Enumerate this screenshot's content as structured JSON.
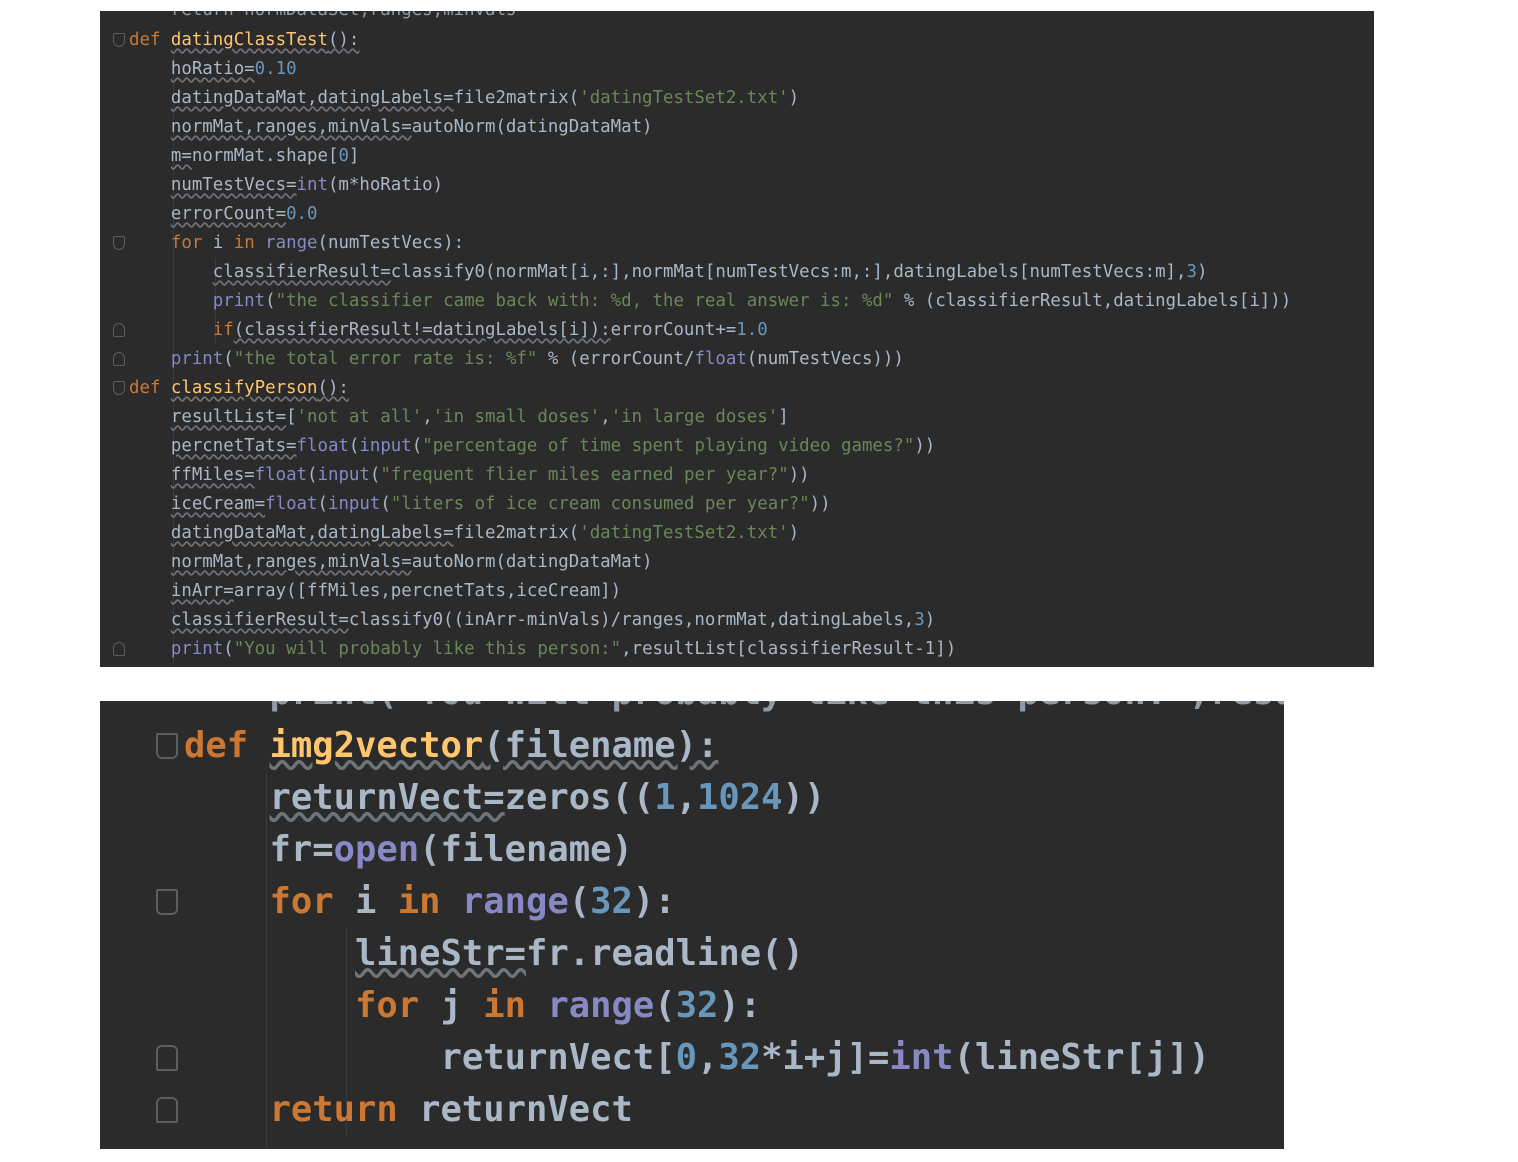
{
  "top_editor": {
    "ghost": "    return normDataSet,ranges,minVals",
    "lines": [
      [
        {
          "t": "def ",
          "c": "kw"
        },
        {
          "t": "datingClassTest",
          "c": "fn wav"
        },
        {
          "t": "():",
          "c": "wav"
        }
      ],
      [
        {
          "t": "    "
        },
        {
          "t": "hoRatio=",
          "c": "wav"
        },
        {
          "t": "0.10",
          "c": "num"
        }
      ],
      [
        {
          "t": "    "
        },
        {
          "t": "datingDataMat,datingLabels=",
          "c": "wav"
        },
        {
          "t": "file2matrix("
        },
        {
          "t": "'datingTestSet2.txt'",
          "c": "str"
        },
        {
          "t": ")"
        }
      ],
      [
        {
          "t": "    "
        },
        {
          "t": "normMat,ranges,minVals=",
          "c": "wav"
        },
        {
          "t": "autoNorm(datingDataMat)"
        }
      ],
      [
        {
          "t": "    "
        },
        {
          "t": "m=",
          "c": "wav"
        },
        {
          "t": "normMat.shape["
        },
        {
          "t": "0",
          "c": "num"
        },
        {
          "t": "]"
        }
      ],
      [
        {
          "t": "    "
        },
        {
          "t": "numTestVecs=",
          "c": "wav"
        },
        {
          "t": "int",
          "c": "bi"
        },
        {
          "t": "(m*hoRatio)"
        }
      ],
      [
        {
          "t": "    "
        },
        {
          "t": "errorCount=",
          "c": "wav"
        },
        {
          "t": "0.0",
          "c": "num"
        }
      ],
      [
        {
          "t": "    "
        },
        {
          "t": "for ",
          "c": "kw"
        },
        {
          "t": "i "
        },
        {
          "t": "in ",
          "c": "kw"
        },
        {
          "t": "range",
          "c": "bi"
        },
        {
          "t": "(numTestVecs):"
        }
      ],
      [
        {
          "t": "        "
        },
        {
          "t": "classifierResult=",
          "c": "wav"
        },
        {
          "t": "classify0(normMat[i,:],normMat[numTestVecs:m,:],datingLabels[numTestVecs:m],"
        },
        {
          "t": "3",
          "c": "num"
        },
        {
          "t": ")"
        }
      ],
      [
        {
          "t": "        "
        },
        {
          "t": "print",
          "c": "bi"
        },
        {
          "t": "("
        },
        {
          "t": "\"the classifier came back with: %d, the real answer is: %d\"",
          "c": "str"
        },
        {
          "t": " % (classifierResult,datingLabels[i]))"
        }
      ],
      [
        {
          "t": "        "
        },
        {
          "t": "if",
          "c": "kw"
        },
        {
          "t": "(classifierResult!=datingLabels[i]):",
          "c": "wav"
        },
        {
          "t": "errorCount+="
        },
        {
          "t": "1.0",
          "c": "num"
        }
      ],
      [
        {
          "t": "    "
        },
        {
          "t": "print",
          "c": "bi"
        },
        {
          "t": "("
        },
        {
          "t": "\"the total error rate is: %f\"",
          "c": "str"
        },
        {
          "t": " % (errorCount/"
        },
        {
          "t": "float",
          "c": "bi"
        },
        {
          "t": "(numTestVecs)))"
        }
      ],
      [
        {
          "t": "def ",
          "c": "kw"
        },
        {
          "t": "classifyPerson",
          "c": "fn wav"
        },
        {
          "t": "():",
          "c": "wav"
        }
      ],
      [
        {
          "t": "    "
        },
        {
          "t": "resultList=",
          "c": "wav"
        },
        {
          "t": "["
        },
        {
          "t": "'not at all'",
          "c": "str"
        },
        {
          "t": ","
        },
        {
          "t": "'in small doses'",
          "c": "str"
        },
        {
          "t": ","
        },
        {
          "t": "'in large doses'",
          "c": "str"
        },
        {
          "t": "]"
        }
      ],
      [
        {
          "t": "    "
        },
        {
          "t": "percnetTats=",
          "c": "wav"
        },
        {
          "t": "float",
          "c": "bi"
        },
        {
          "t": "("
        },
        {
          "t": "input",
          "c": "bi"
        },
        {
          "t": "("
        },
        {
          "t": "\"percentage of time spent playing video games?\"",
          "c": "str"
        },
        {
          "t": "))"
        }
      ],
      [
        {
          "t": "    "
        },
        {
          "t": "ffMiles=",
          "c": "wav"
        },
        {
          "t": "float",
          "c": "bi"
        },
        {
          "t": "("
        },
        {
          "t": "input",
          "c": "bi"
        },
        {
          "t": "("
        },
        {
          "t": "\"frequent flier miles earned per year?\"",
          "c": "str"
        },
        {
          "t": "))"
        }
      ],
      [
        {
          "t": "    "
        },
        {
          "t": "iceCream=",
          "c": "wav"
        },
        {
          "t": "float",
          "c": "bi"
        },
        {
          "t": "("
        },
        {
          "t": "input",
          "c": "bi"
        },
        {
          "t": "("
        },
        {
          "t": "\"liters of ice cream consumed per year?\"",
          "c": "str"
        },
        {
          "t": "))"
        }
      ],
      [
        {
          "t": "    "
        },
        {
          "t": "datingDataMat,datingLabels=",
          "c": "wav"
        },
        {
          "t": "file2matrix("
        },
        {
          "t": "'datingTestSet2.txt'",
          "c": "str"
        },
        {
          "t": ")"
        }
      ],
      [
        {
          "t": "    "
        },
        {
          "t": "normMat,ranges,minVals=",
          "c": "wav"
        },
        {
          "t": "autoNorm(datingDataMat)"
        }
      ],
      [
        {
          "t": "    "
        },
        {
          "t": "inArr=",
          "c": "wav"
        },
        {
          "t": "array([ffMiles,percnetTats,iceCream])"
        }
      ],
      [
        {
          "t": "    "
        },
        {
          "t": "classifierResult=",
          "c": "wav"
        },
        {
          "t": "classify0((inArr-minVals)/ranges,normMat,datingLabels,"
        },
        {
          "t": "3",
          "c": "num"
        },
        {
          "t": ")"
        }
      ],
      [
        {
          "t": "    "
        },
        {
          "t": "print",
          "c": "bi"
        },
        {
          "t": "("
        },
        {
          "t": "\"You will probably like this person:\"",
          "c": "str"
        },
        {
          "t": ",resultList[classifierResult-1])"
        }
      ]
    ]
  },
  "bottom_editor": {
    "ghost": "    print(\"You will probably like this person:\",result",
    "lines": [
      [
        {
          "t": "def ",
          "c": "kw"
        },
        {
          "t": "img2vector",
          "c": "fn wav"
        },
        {
          "t": "(filename):",
          "c": "wav"
        }
      ],
      [
        {
          "t": "    "
        },
        {
          "t": "returnVect=",
          "c": "wav"
        },
        {
          "t": "zeros(("
        },
        {
          "t": "1",
          "c": "num"
        },
        {
          "t": ","
        },
        {
          "t": "1024",
          "c": "num"
        },
        {
          "t": "))"
        }
      ],
      [
        {
          "t": "    "
        },
        {
          "t": "fr="
        },
        {
          "t": "open",
          "c": "bi"
        },
        {
          "t": "(filename)"
        }
      ],
      [
        {
          "t": "    "
        },
        {
          "t": "for ",
          "c": "kw"
        },
        {
          "t": "i "
        },
        {
          "t": "in ",
          "c": "kw"
        },
        {
          "t": "range",
          "c": "bi"
        },
        {
          "t": "("
        },
        {
          "t": "32",
          "c": "num"
        },
        {
          "t": "):"
        }
      ],
      [
        {
          "t": "        "
        },
        {
          "t": "lineStr=",
          "c": "wav"
        },
        {
          "t": "fr.readline()"
        }
      ],
      [
        {
          "t": "        "
        },
        {
          "t": "for ",
          "c": "kw"
        },
        {
          "t": "j "
        },
        {
          "t": "in ",
          "c": "kw"
        },
        {
          "t": "range",
          "c": "bi"
        },
        {
          "t": "("
        },
        {
          "t": "32",
          "c": "num"
        },
        {
          "t": "):"
        }
      ],
      [
        {
          "t": "            "
        },
        {
          "t": "returnVect["
        },
        {
          "t": "0",
          "c": "num"
        },
        {
          "t": ","
        },
        {
          "t": "32",
          "c": "num"
        },
        {
          "t": "*i+j]="
        },
        {
          "t": "int",
          "c": "bi"
        },
        {
          "t": "(lineStr[j])"
        }
      ],
      [
        {
          "t": "    "
        },
        {
          "t": "return ",
          "c": "kw"
        },
        {
          "t": "returnVect"
        }
      ]
    ]
  }
}
